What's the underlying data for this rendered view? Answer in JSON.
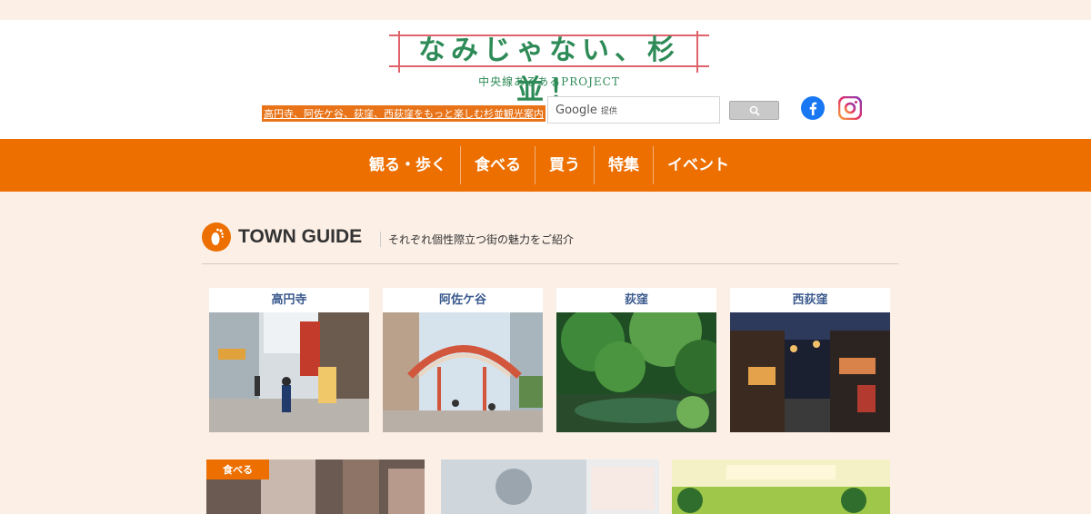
{
  "header": {
    "logo_title": "なみじゃない、杉並！",
    "logo_sub": "中央線あるあるPROJECT",
    "tagline": "高円寺、阿佐ケ谷、荻窪、西荻窪をもっと楽しむ杉並観光案内",
    "search_placeholder": "",
    "search_google": "Google",
    "search_provided": "提供"
  },
  "nav": {
    "items": [
      {
        "label": "観る・歩く"
      },
      {
        "label": "食べる"
      },
      {
        "label": "買う"
      },
      {
        "label": "特集"
      },
      {
        "label": "イベント"
      }
    ]
  },
  "section": {
    "title": "TOWN GUIDE",
    "subtitle": "それぞれ個性際立つ街の魅力をご紹介"
  },
  "towns": [
    {
      "name": "高円寺"
    },
    {
      "name": "阿佐ケ谷"
    },
    {
      "name": "荻窪"
    },
    {
      "name": "西荻窪"
    }
  ],
  "features": [
    {
      "tag": "食べる"
    }
  ],
  "colors": {
    "accent": "#ec6f00",
    "background": "#fcefe6",
    "logo_green": "#2e8b57",
    "logo_red": "#e0626b",
    "town_label": "#3b5a8e"
  }
}
